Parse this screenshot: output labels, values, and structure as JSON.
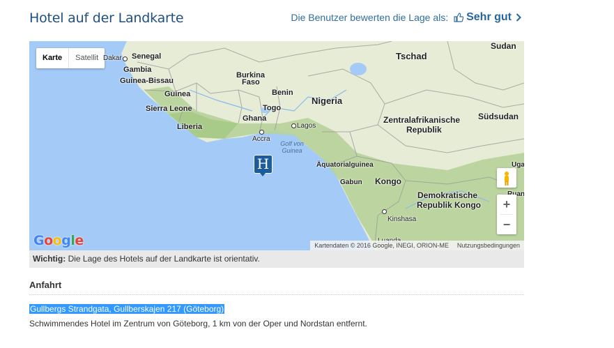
{
  "header": {
    "title": "Hotel auf der Landkarte",
    "rating_prefix": "Die Benutzer bewerten die Lage als:",
    "rating_value": "Sehr gut",
    "thumb_icon": "thumbs-up-icon",
    "chevron_icon": "chevron-right-icon"
  },
  "map": {
    "map_type_options": [
      "Karte",
      "Satellit"
    ],
    "selected_type": "Karte",
    "labels": {
      "dakar": "Dakar",
      "senegal": "Senegal",
      "gambia": "Gambia",
      "guinea_bissau": "Guinea-Bissau",
      "guinea": "Guinea",
      "sierra_leone": "Sierra Leone",
      "liberia": "Liberia",
      "burkina": "Burkina",
      "faso": "Faso",
      "benin": "Benin",
      "togo": "Togo",
      "ghana": "Ghana",
      "accra": "Accra",
      "lagos": "Lagos",
      "nigeria": "Nigeria",
      "tschad": "Tschad",
      "sudan": "Sudan",
      "suedsudan": "Südsudan",
      "zar1": "Zentralafrikanische",
      "zar2": "Republik",
      "golf1": "Golf von",
      "golf2": "Guinea",
      "aeqgui": "Äquatorialguinea",
      "gabun": "Gabun",
      "kongo": "Kongo",
      "drk1": "Demokratische",
      "drk2": "Republik Kongo",
      "kinshasa": "Kinshasa",
      "uganda": "Uga",
      "ruanda": "Ruanda",
      "luanda": "Luanda"
    },
    "marker_letter": "H",
    "zoom_in": "+",
    "zoom_out": "−",
    "logo": "Google",
    "attribution": "Kartendaten © 2016 Google, INEGI, ORION-ME",
    "terms": "Nutzungsbedingungen"
  },
  "notice": {
    "bold": "Wichtig:",
    "text": "Die Lage des Hotels auf der Landkarte ist orientativ."
  },
  "directions": {
    "heading": "Anfahrt",
    "address": "Gullbergs Strandgata, Gullberskajen 217 (Göteborg)",
    "description": "Schwimmendes Hotel im Zentrum von Göteborg, 1 km von der Oper und Nordstan entfernt."
  },
  "colors": {
    "title": "#1f4f7f",
    "water": "#a4cbf7",
    "land": "#e6ecd6",
    "forest": "#b7d39a",
    "marker": "#1d5c9a",
    "selection": "#3399ff"
  }
}
